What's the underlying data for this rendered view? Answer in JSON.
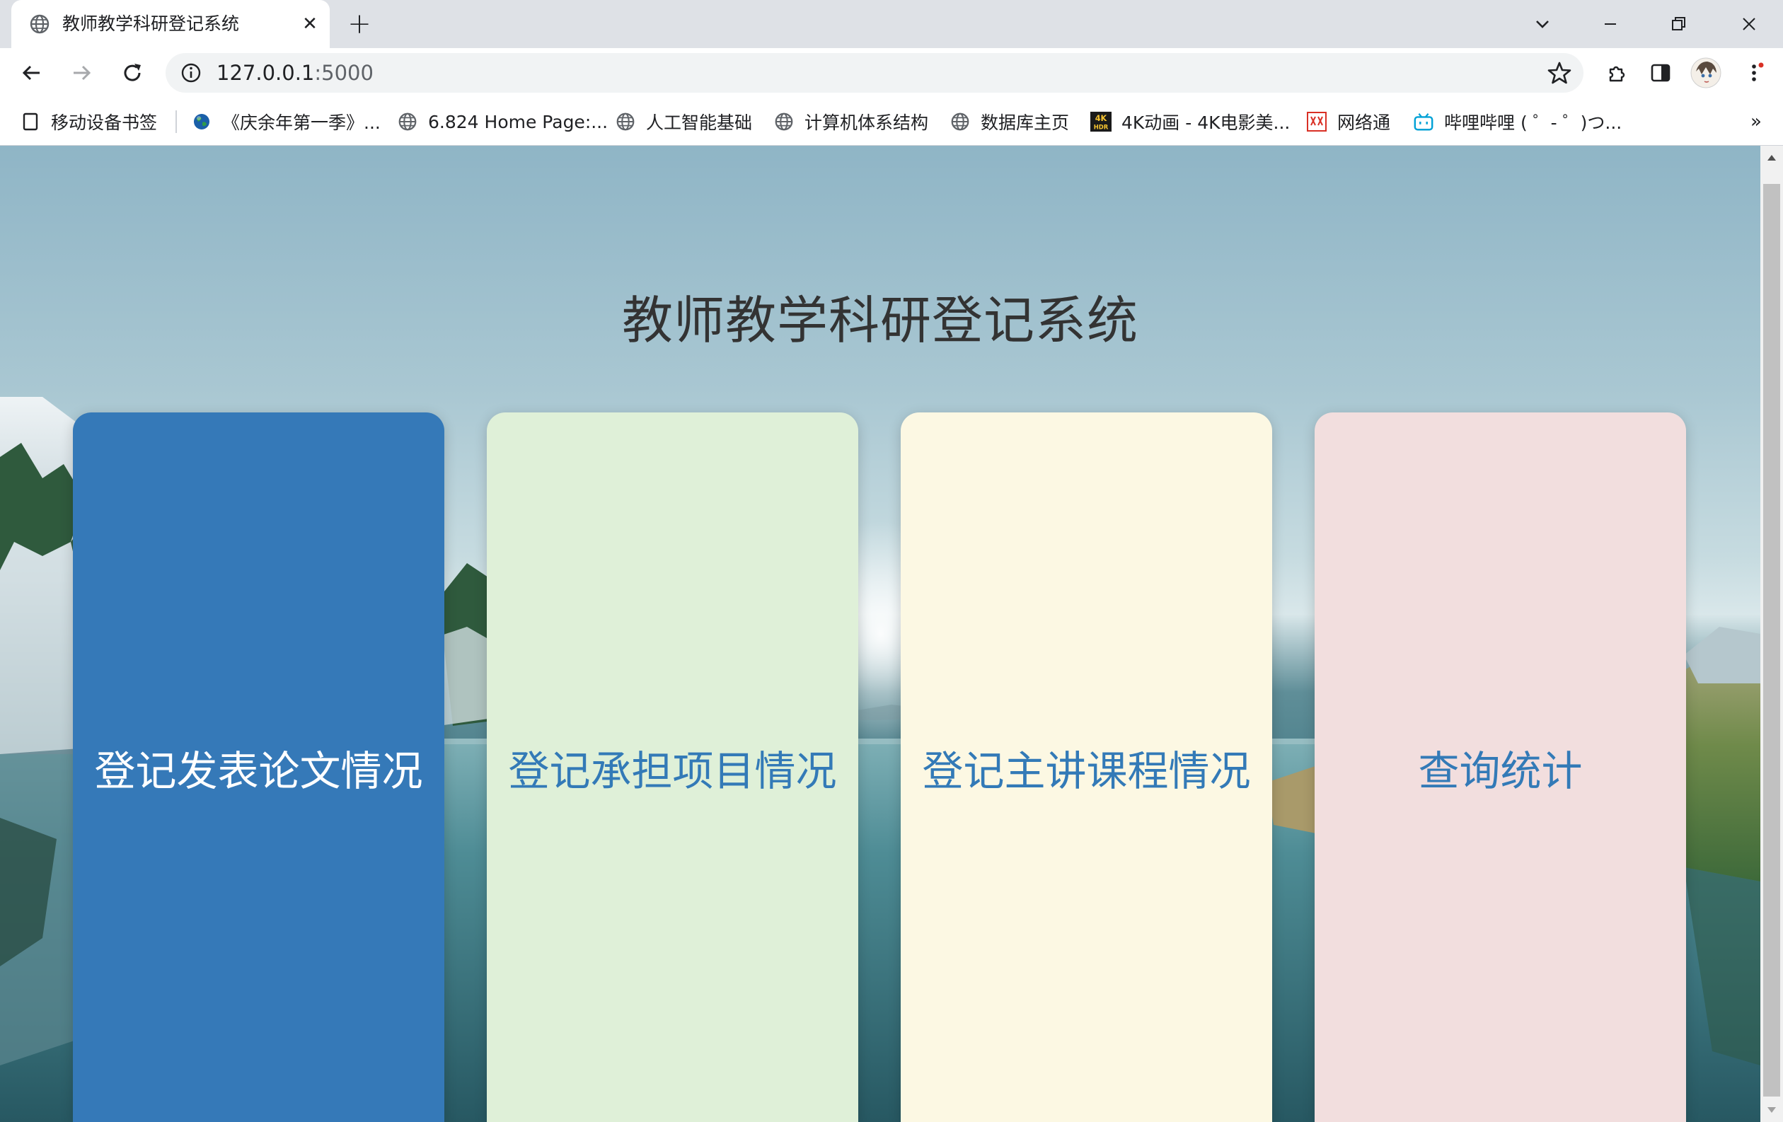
{
  "browser": {
    "tab": {
      "title": "教师教学科研登记系统",
      "close": "✕"
    },
    "new_tab": "+",
    "url": {
      "host": "127.0.0.1",
      "port": ":5000"
    },
    "bookmarks": [
      {
        "label": "移动设备书签",
        "icon": "bookmark-folder-icon"
      },
      {
        "label": "《庆余年第一季》...",
        "icon": "earth-icon"
      },
      {
        "label": "6.824 Home Page:...",
        "icon": "globe-icon"
      },
      {
        "label": "人工智能基础",
        "icon": "globe-icon"
      },
      {
        "label": "计算机体系结构",
        "icon": "globe-icon"
      },
      {
        "label": "数据库主页",
        "icon": "globe-icon"
      },
      {
        "label": "4K动画 - 4K电影美...",
        "icon": "4k-hdr-icon"
      },
      {
        "label": "网络通",
        "icon": "wangluotong-icon"
      },
      {
        "label": "哔哩哔哩 ( ゜- ゜)つ...",
        "icon": "bilibili-icon"
      }
    ],
    "bookmarks_more": "»"
  },
  "page": {
    "title": "教师教学科研登记系统",
    "cards": [
      {
        "label": "登记发表论文情况",
        "bg": "#3579b8",
        "fg": "#ffffff"
      },
      {
        "label": "登记承担项目情况",
        "bg": "#dff0d8",
        "fg": "#337ab7"
      },
      {
        "label": "登记主讲课程情况",
        "bg": "#fcf8e3",
        "fg": "#337ab7"
      },
      {
        "label": "查询统计",
        "bg": "#f2dede",
        "fg": "#337ab7"
      }
    ]
  }
}
